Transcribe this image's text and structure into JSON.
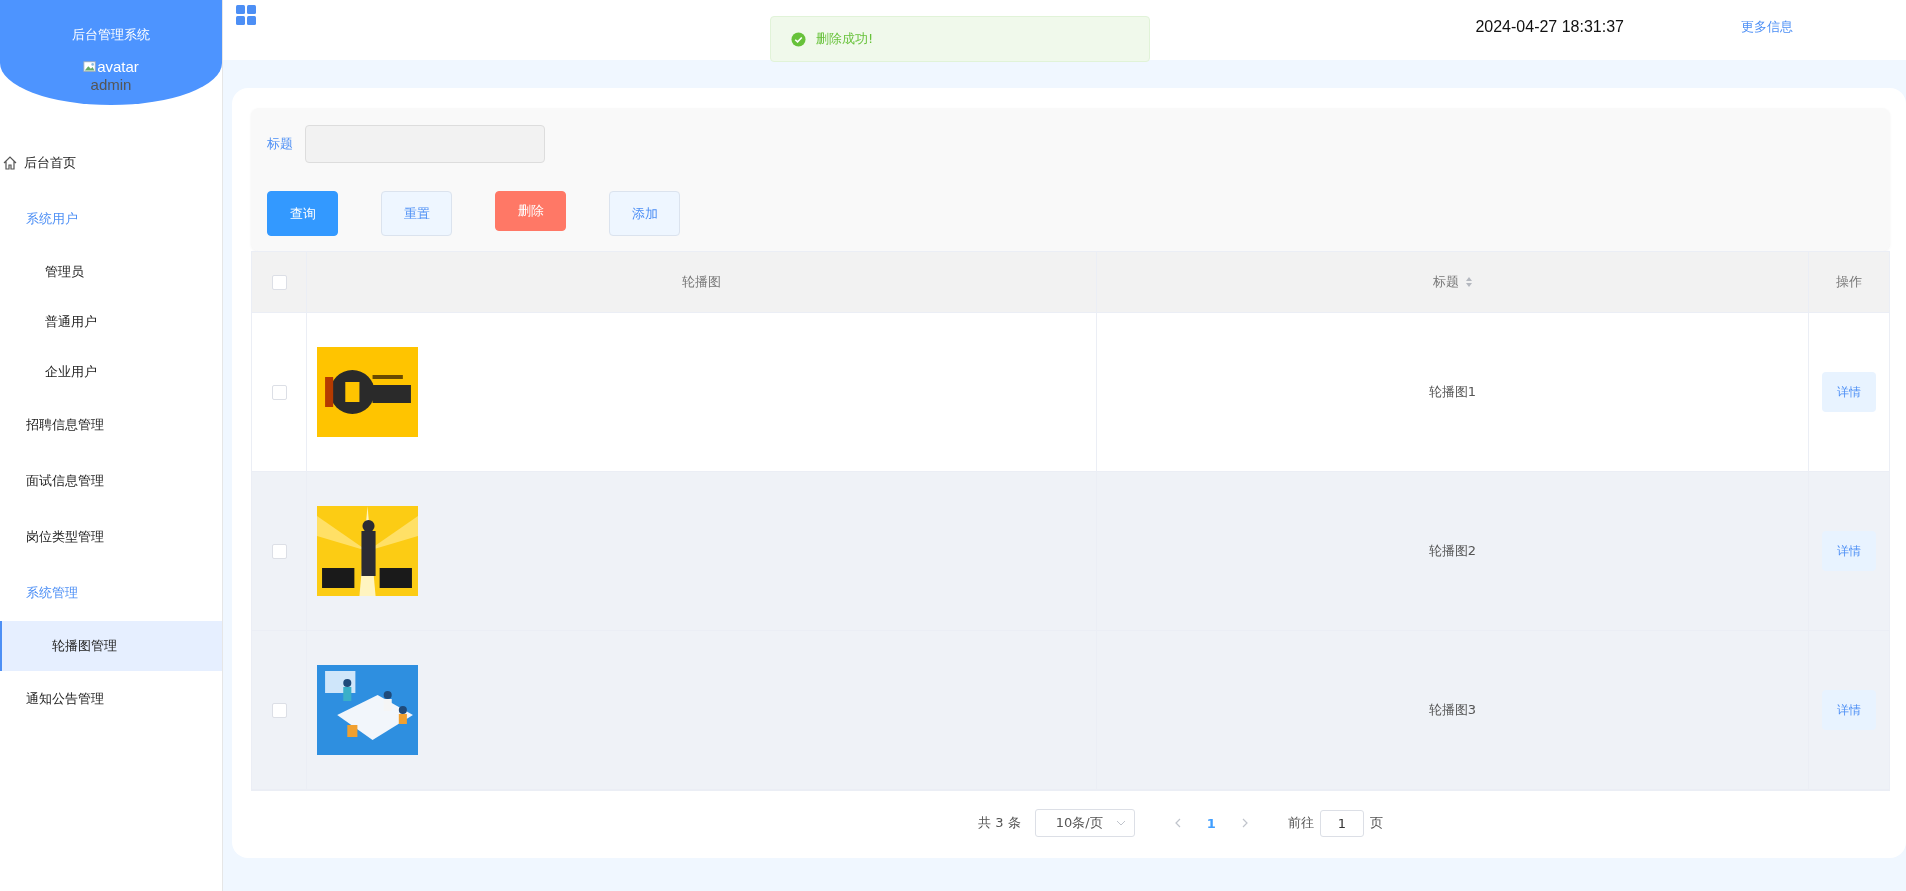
{
  "sidebar": {
    "title": "后台管理系统",
    "avatar_alt": "avatar",
    "username": "admin",
    "items": [
      {
        "label": "后台首页",
        "kind": "link",
        "selected": false
      },
      {
        "label": "系统用户",
        "kind": "group",
        "children": [
          {
            "label": "管理员",
            "selected": false
          },
          {
            "label": "普通用户",
            "selected": false
          },
          {
            "label": "企业用户",
            "selected": false
          }
        ]
      },
      {
        "label": "招聘信息管理",
        "kind": "plain",
        "selected": false
      },
      {
        "label": "面试信息管理",
        "kind": "plain",
        "selected": false
      },
      {
        "label": "岗位类型管理",
        "kind": "plain",
        "selected": false
      },
      {
        "label": "系统管理",
        "kind": "group",
        "children": [
          {
            "label": "轮播图管理",
            "selected": true
          }
        ]
      },
      {
        "label": "通知公告管理",
        "kind": "plain",
        "selected": false
      }
    ]
  },
  "header": {
    "time": "2024-04-27 18:31:37",
    "more_link": "更多信息"
  },
  "toast": {
    "message": "删除成功!"
  },
  "search": {
    "label": "标题"
  },
  "buttons": [
    {
      "label": "查询",
      "kind": "primary"
    },
    {
      "label": "重置",
      "kind": "plain"
    },
    {
      "label": "删除",
      "kind": "danger"
    },
    {
      "label": "添加",
      "kind": "plain"
    }
  ],
  "table": {
    "select_all": {
      "checked": false
    },
    "columns": [
      {
        "label": "轮播图",
        "kind": "plain"
      },
      {
        "label": "标题",
        "kind": "sortable"
      },
      {
        "label": "操作",
        "kind": "plain"
      }
    ],
    "rows": [
      {
        "checked": false,
        "highlighted": false,
        "title": "轮播图1",
        "action": "详情"
      },
      {
        "checked": false,
        "highlighted": true,
        "title": "轮播图2",
        "action": "详情"
      },
      {
        "checked": false,
        "highlighted": true,
        "title": "轮播图3",
        "action": "详情"
      }
    ]
  },
  "pagination": {
    "total": "共 3 条",
    "page_size": "10条/页",
    "pages": [
      {
        "label": "1",
        "selected": true
      }
    ],
    "goto": "前往",
    "goto_value": "1",
    "unit": "页"
  }
}
